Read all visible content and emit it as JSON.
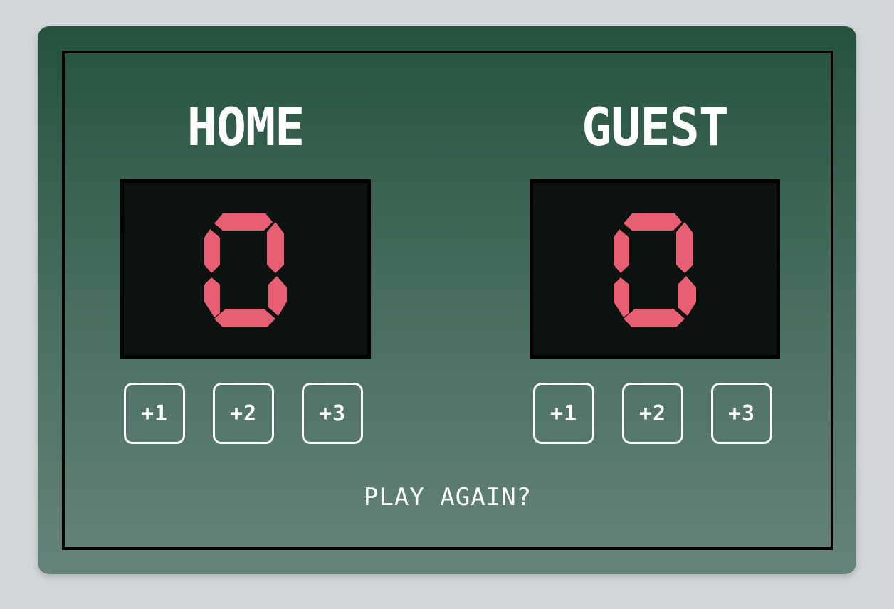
{
  "home": {
    "name": "HOME",
    "score": "0",
    "buttons": [
      "+1",
      "+2",
      "+3"
    ]
  },
  "guest": {
    "name": "GUEST",
    "score": "0",
    "buttons": [
      "+1",
      "+2",
      "+3"
    ]
  },
  "play_again_label": "PLAY AGAIN?",
  "colors": {
    "board_top": "#25523f",
    "board_bottom": "#66837a",
    "score_digit": "#e85f74",
    "score_background": "#0b1210",
    "page_background": "#d3d6db"
  }
}
